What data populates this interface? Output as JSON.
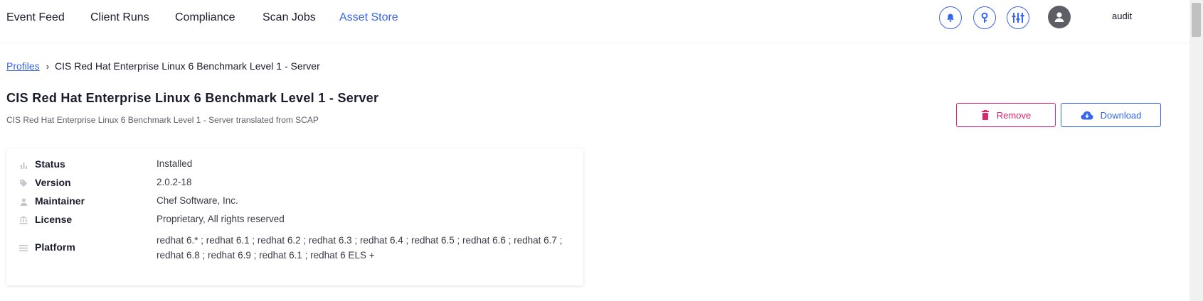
{
  "nav": {
    "links": [
      {
        "label": "Event Feed"
      },
      {
        "label": "Client Runs"
      },
      {
        "label": "Compliance"
      },
      {
        "label": "Scan Jobs"
      },
      {
        "label": "Asset Store"
      }
    ],
    "active_link": "Asset Store",
    "icons": [
      "bell-icon",
      "key-icon",
      "apps-icon"
    ],
    "username": "audit"
  },
  "breadcrumb": {
    "root": "Profiles",
    "separator": "›",
    "current": "CIS Red Hat Enterprise Linux 6 Benchmark Level 1 - Server"
  },
  "profile": {
    "title": "CIS Red Hat Enterprise Linux 6 Benchmark Level 1 - Server",
    "subtitle": "CIS Red Hat Enterprise Linux 6 Benchmark Level 1 - Server translated from SCAP"
  },
  "actions": {
    "remove_label": "Remove",
    "download_label": "Download"
  },
  "metadata": [
    {
      "label": "Status",
      "value": "Installed",
      "icon": "bar-chart-icon"
    },
    {
      "label": "Version",
      "value": "2.0.2-18",
      "icon": "tag-icon"
    },
    {
      "label": "Maintainer",
      "value": "Chef Software, Inc.",
      "icon": "person-icon"
    },
    {
      "label": "License",
      "value": "Proprietary, All rights reserved",
      "icon": "bank-icon"
    },
    {
      "label": "Platform",
      "value": "redhat 6.* ; redhat 6.1 ; redhat 6.2 ; redhat 6.3 ; redhat 6.4 ; redhat 6.5 ; redhat 6.6 ; redhat 6.7 ; redhat 6.8 ; redhat 6.9 ; redhat 6.1 ; redhat 6 ELS +",
      "icon": "list-icon"
    }
  ],
  "colors": {
    "accent": "#3864f2",
    "danger": "#e0256f",
    "text": "#1b1b2e",
    "muted_icon": "#c5c7d0"
  }
}
